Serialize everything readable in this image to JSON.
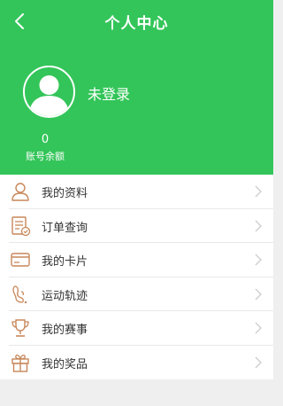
{
  "header": {
    "title": "个人中心",
    "back_icon": "chevron-left-icon"
  },
  "profile": {
    "status": "未登录",
    "avatar_icon": "user-avatar-icon",
    "balance_value": "0",
    "balance_label": "账号余额"
  },
  "menu": {
    "items": [
      {
        "label": "我的资料",
        "icon": "person-icon"
      },
      {
        "label": "订单查询",
        "icon": "order-list-icon"
      },
      {
        "label": "我的卡片",
        "icon": "card-icon"
      },
      {
        "label": "运动轨迹",
        "icon": "footprint-icon"
      },
      {
        "label": "我的赛事",
        "icon": "trophy-icon"
      },
      {
        "label": "我的奖品",
        "icon": "gift-icon"
      }
    ]
  },
  "colors": {
    "header_green": "#33c559",
    "icon_orange": "#c8875a",
    "background": "#efefef"
  }
}
